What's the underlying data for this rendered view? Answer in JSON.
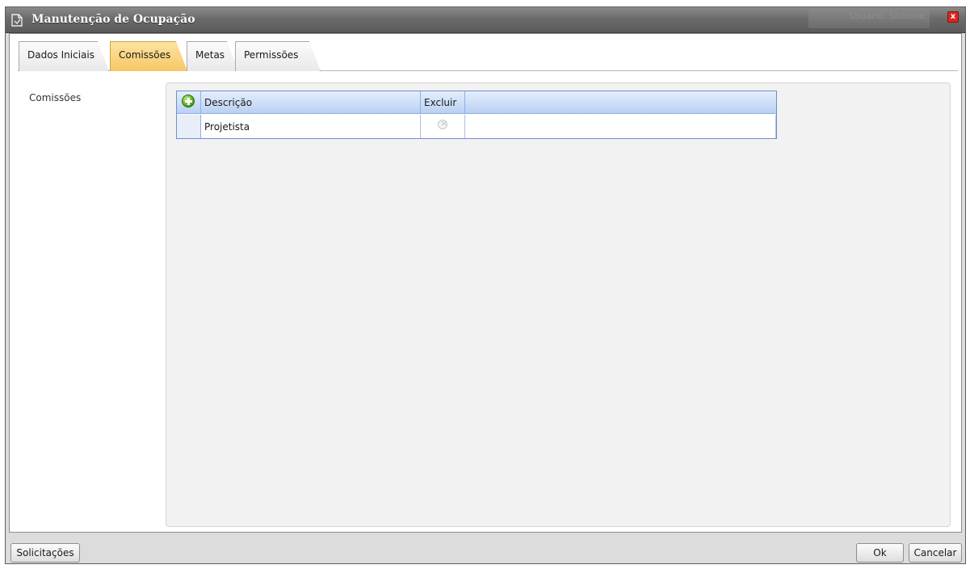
{
  "window": {
    "title": "Manutenção de Ocupação",
    "user_info": "Usuário: Sistema",
    "close_label": "x"
  },
  "tabs": [
    {
      "label": "Dados Iniciais",
      "active": false
    },
    {
      "label": "Comissões",
      "active": true
    },
    {
      "label": "Metas",
      "active": false
    },
    {
      "label": "Permissões",
      "active": false
    }
  ],
  "section": {
    "label": "Comissões"
  },
  "grid": {
    "columns": [
      "Descrição",
      "Excluir"
    ],
    "rows": [
      {
        "descricao": "Projetista"
      }
    ]
  },
  "footer": {
    "solicitacoes_label": "Solicitações",
    "ok_label": "Ok",
    "cancelar_label": "Cancelar"
  },
  "colors": {
    "title_bar": "#6b6b6b",
    "active_tab": "#f6c766",
    "grid_header": "#cfe0f8",
    "grid_border": "#6d90c9"
  }
}
